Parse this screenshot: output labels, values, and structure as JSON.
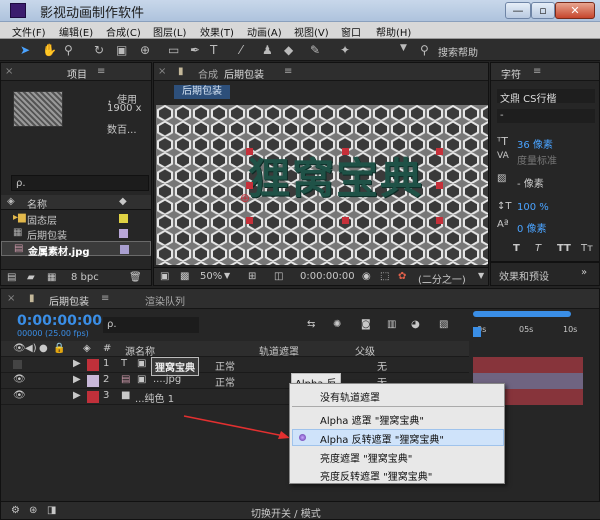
{
  "window": {
    "title": "影视动画制作软件",
    "min": "—",
    "max": "▫",
    "close": "✕"
  },
  "menu": [
    "文件(F)",
    "编辑(E)",
    "合成(C)",
    "图层(L)",
    "效果(T)",
    "动画(A)",
    "视图(V)",
    "窗口",
    "帮助(H)"
  ],
  "toolbar": {
    "search_label": "搜索帮助"
  },
  "project": {
    "tab": "项目",
    "preview_line1": "，使用",
    "preview_line2": "1900 x",
    "preview_line3": "数百...",
    "search": "ρ.",
    "col_name": "名称",
    "items": [
      {
        "name": "固态层",
        "type": "folder"
      },
      {
        "name": "后期包装",
        "type": "comp"
      },
      {
        "name": "金属素材.jpg",
        "type": "image"
      }
    ],
    "bpc": "8 bpc"
  },
  "comp": {
    "tab_prefix": "合成",
    "tab_name": "后期包装",
    "subtab": "后期包装",
    "logo_text": "狸窝宝典",
    "zoom": "50%",
    "timecode": "0:00:00:00",
    "res": "(二分之一)"
  },
  "character": {
    "tab": "字符",
    "font": "文鼎 CS行楷",
    "style": "-",
    "size": "36 像素",
    "kerning": "度量标准",
    "stroke": "- 像素",
    "vscale": "100 %",
    "baseline": "0 像素",
    "effects_tab": "效果和预设"
  },
  "timeline": {
    "tab": "后期包装",
    "render_tab": "渲染队列",
    "timecode": "0:00:00:00",
    "fps": "00000 (25.00 fps)",
    "search": "ρ.",
    "col_num": "#",
    "col_source": "源名称",
    "col_mode": "轨道遮罩",
    "col_parent": "父级",
    "col_trkmat": "",
    "ruler": [
      "0s",
      "05s",
      "10s"
    ],
    "footer": "切换开关 / 模式",
    "layers": [
      {
        "num": "1",
        "name": "狸窝宝典",
        "mode": "正常",
        "trkmat": "",
        "parent": "无",
        "color": "#c0303a"
      },
      {
        "num": "2",
        "name": "....jpg",
        "mode": "正常",
        "trkmat": "Alpha 反",
        "parent": "无",
        "color": "#c8b8d8"
      },
      {
        "num": "3",
        "name": "...纯色 1",
        "mode": "正常",
        "trkmat": "",
        "parent": "无",
        "color": "#c0303a"
      }
    ]
  },
  "dropdown": {
    "options": [
      "没有轨道遮罩",
      "Alpha 遮罩 \"狸窝宝典\"",
      "Alpha 反转遮罩 \"狸窝宝典\"",
      "亮度遮罩 \"狸窝宝典\"",
      "亮度反转遮罩 \"狸窝宝典\""
    ],
    "selected_index": 2
  },
  "colors": {
    "accent": "#3a8ee6",
    "timecode": "#3a8ee6",
    "layer_red": "#c0303a"
  }
}
